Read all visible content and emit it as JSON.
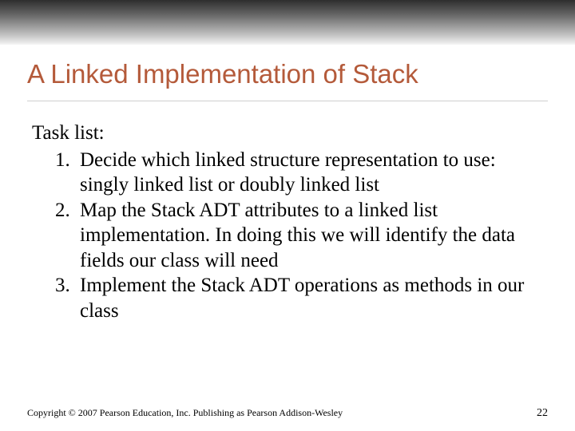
{
  "slide": {
    "title": "A Linked Implementation of Stack",
    "leadin": "Task list:",
    "tasks": [
      "Decide which linked structure representation to use: singly linked list or doubly linked list",
      "Map the Stack ADT attributes to a linked list implementation. In doing this we will identify the data fields our class will need",
      "Implement the Stack ADT operations as methods in our class"
    ],
    "copyright": "Copyright © 2007 Pearson Education, Inc. Publishing as Pearson Addison-Wesley",
    "page_number": "22"
  }
}
